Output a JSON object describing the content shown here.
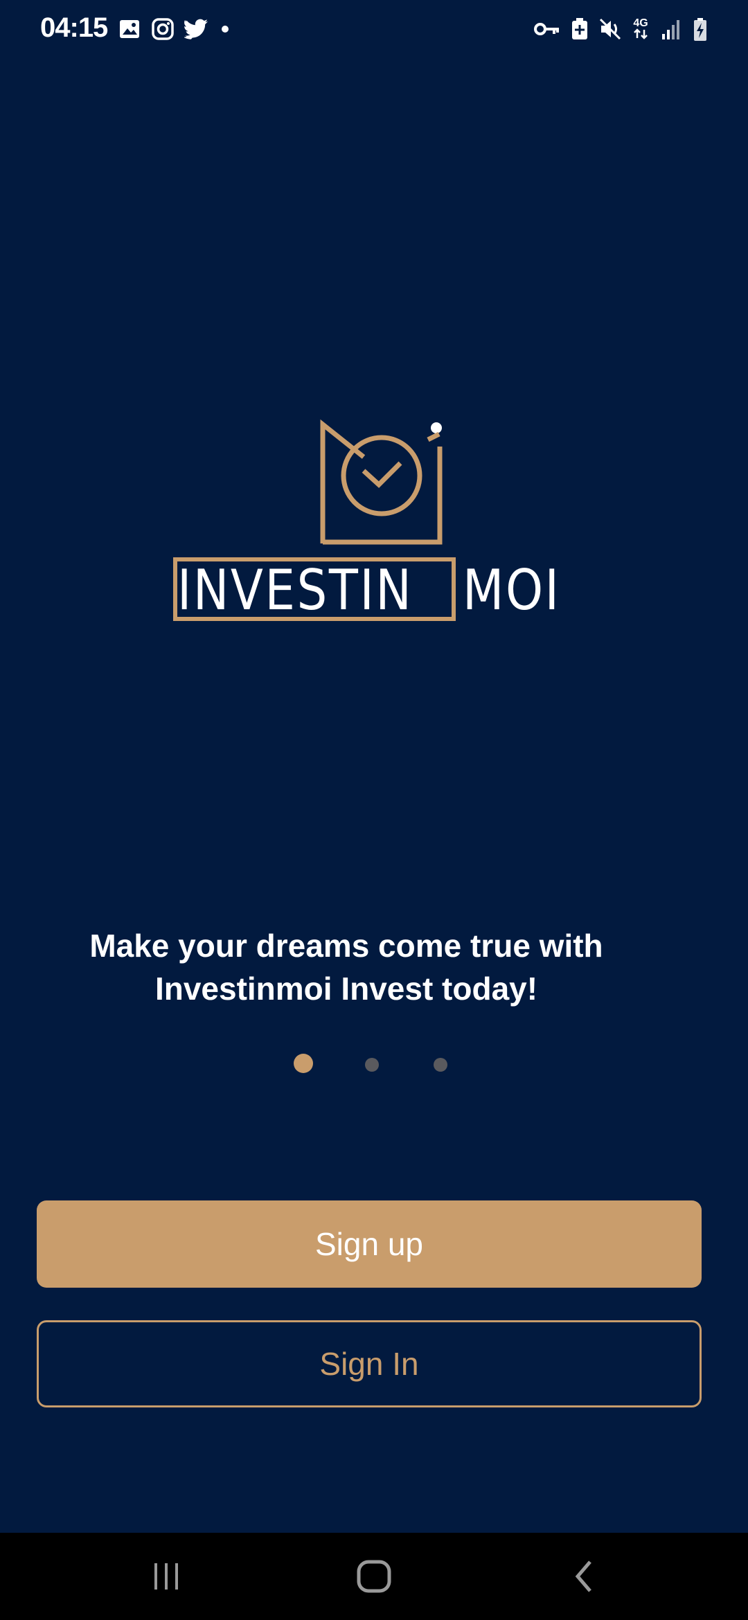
{
  "status_bar": {
    "time": "04:15",
    "left_icons": [
      "gallery-icon",
      "instagram-icon",
      "twitter-icon",
      "notification-dot-icon"
    ],
    "right_icons": [
      "vpn-key-icon",
      "battery-saver-icon",
      "mute-icon",
      "network-4g-icon",
      "signal-icon",
      "battery-charging-icon"
    ],
    "network_label": "4G"
  },
  "logo": {
    "brand_first": "INVESTIN",
    "brand_second": "MOI",
    "mark_icon": "envelope-check-icon",
    "colors": {
      "gold": "#c99d6c",
      "white": "#ffffff"
    }
  },
  "onboarding": {
    "tagline": "Make your dreams come true with Investinmoi Invest today!",
    "pages_total": 3,
    "current_page": 1
  },
  "actions": {
    "signup_label": "Sign up",
    "signin_label": "Sign In"
  },
  "nav_bar": {
    "items": [
      "recent-apps-icon",
      "home-icon",
      "back-icon"
    ]
  },
  "theme": {
    "background": "#021a3f",
    "accent": "#c99d6c",
    "dot_inactive": "#5a5a5e"
  }
}
